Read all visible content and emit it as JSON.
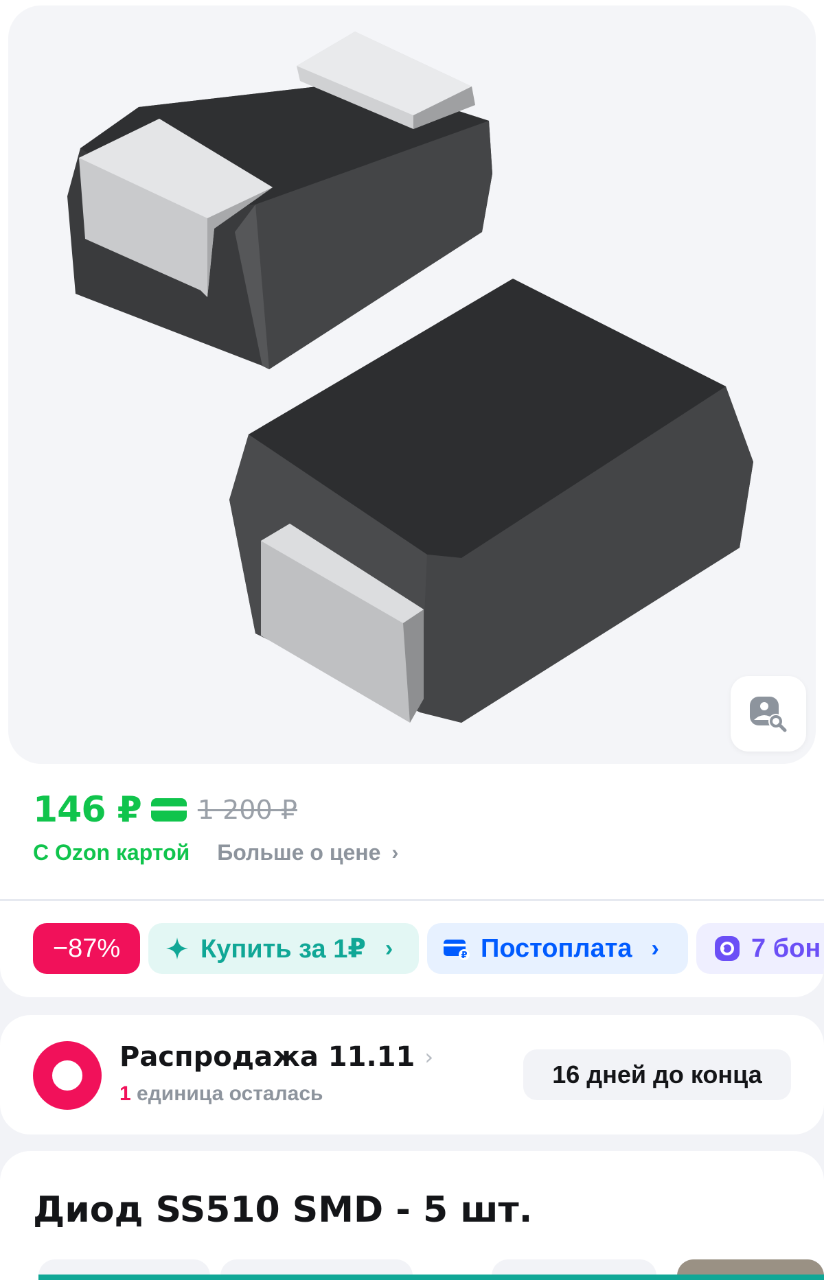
{
  "gallery": {
    "lens_button_icon": "image-search-icon"
  },
  "price": {
    "current": "146 ₽",
    "old": "1 200 ₽",
    "card_icon": "ozon-card-icon",
    "with_card_label": "С Ozon картой",
    "more_label": "Больше о цене"
  },
  "chips": {
    "discount": "−87%",
    "buy_for_one": "Купить за 1₽",
    "postpay": "Постоплата",
    "bonus": "7 бон"
  },
  "sale": {
    "title": "Распродажа 11.11",
    "units_left_num": "1",
    "units_left_text": "единица осталась",
    "days_left": "16 дней до конца"
  },
  "product": {
    "title": "Диод SS510 SMD - 5 шт."
  },
  "colors": {
    "green": "#10c44c",
    "pink": "#f1115a",
    "teal": "#10a796",
    "blue": "#005bff",
    "violet": "#6b4ff6"
  }
}
